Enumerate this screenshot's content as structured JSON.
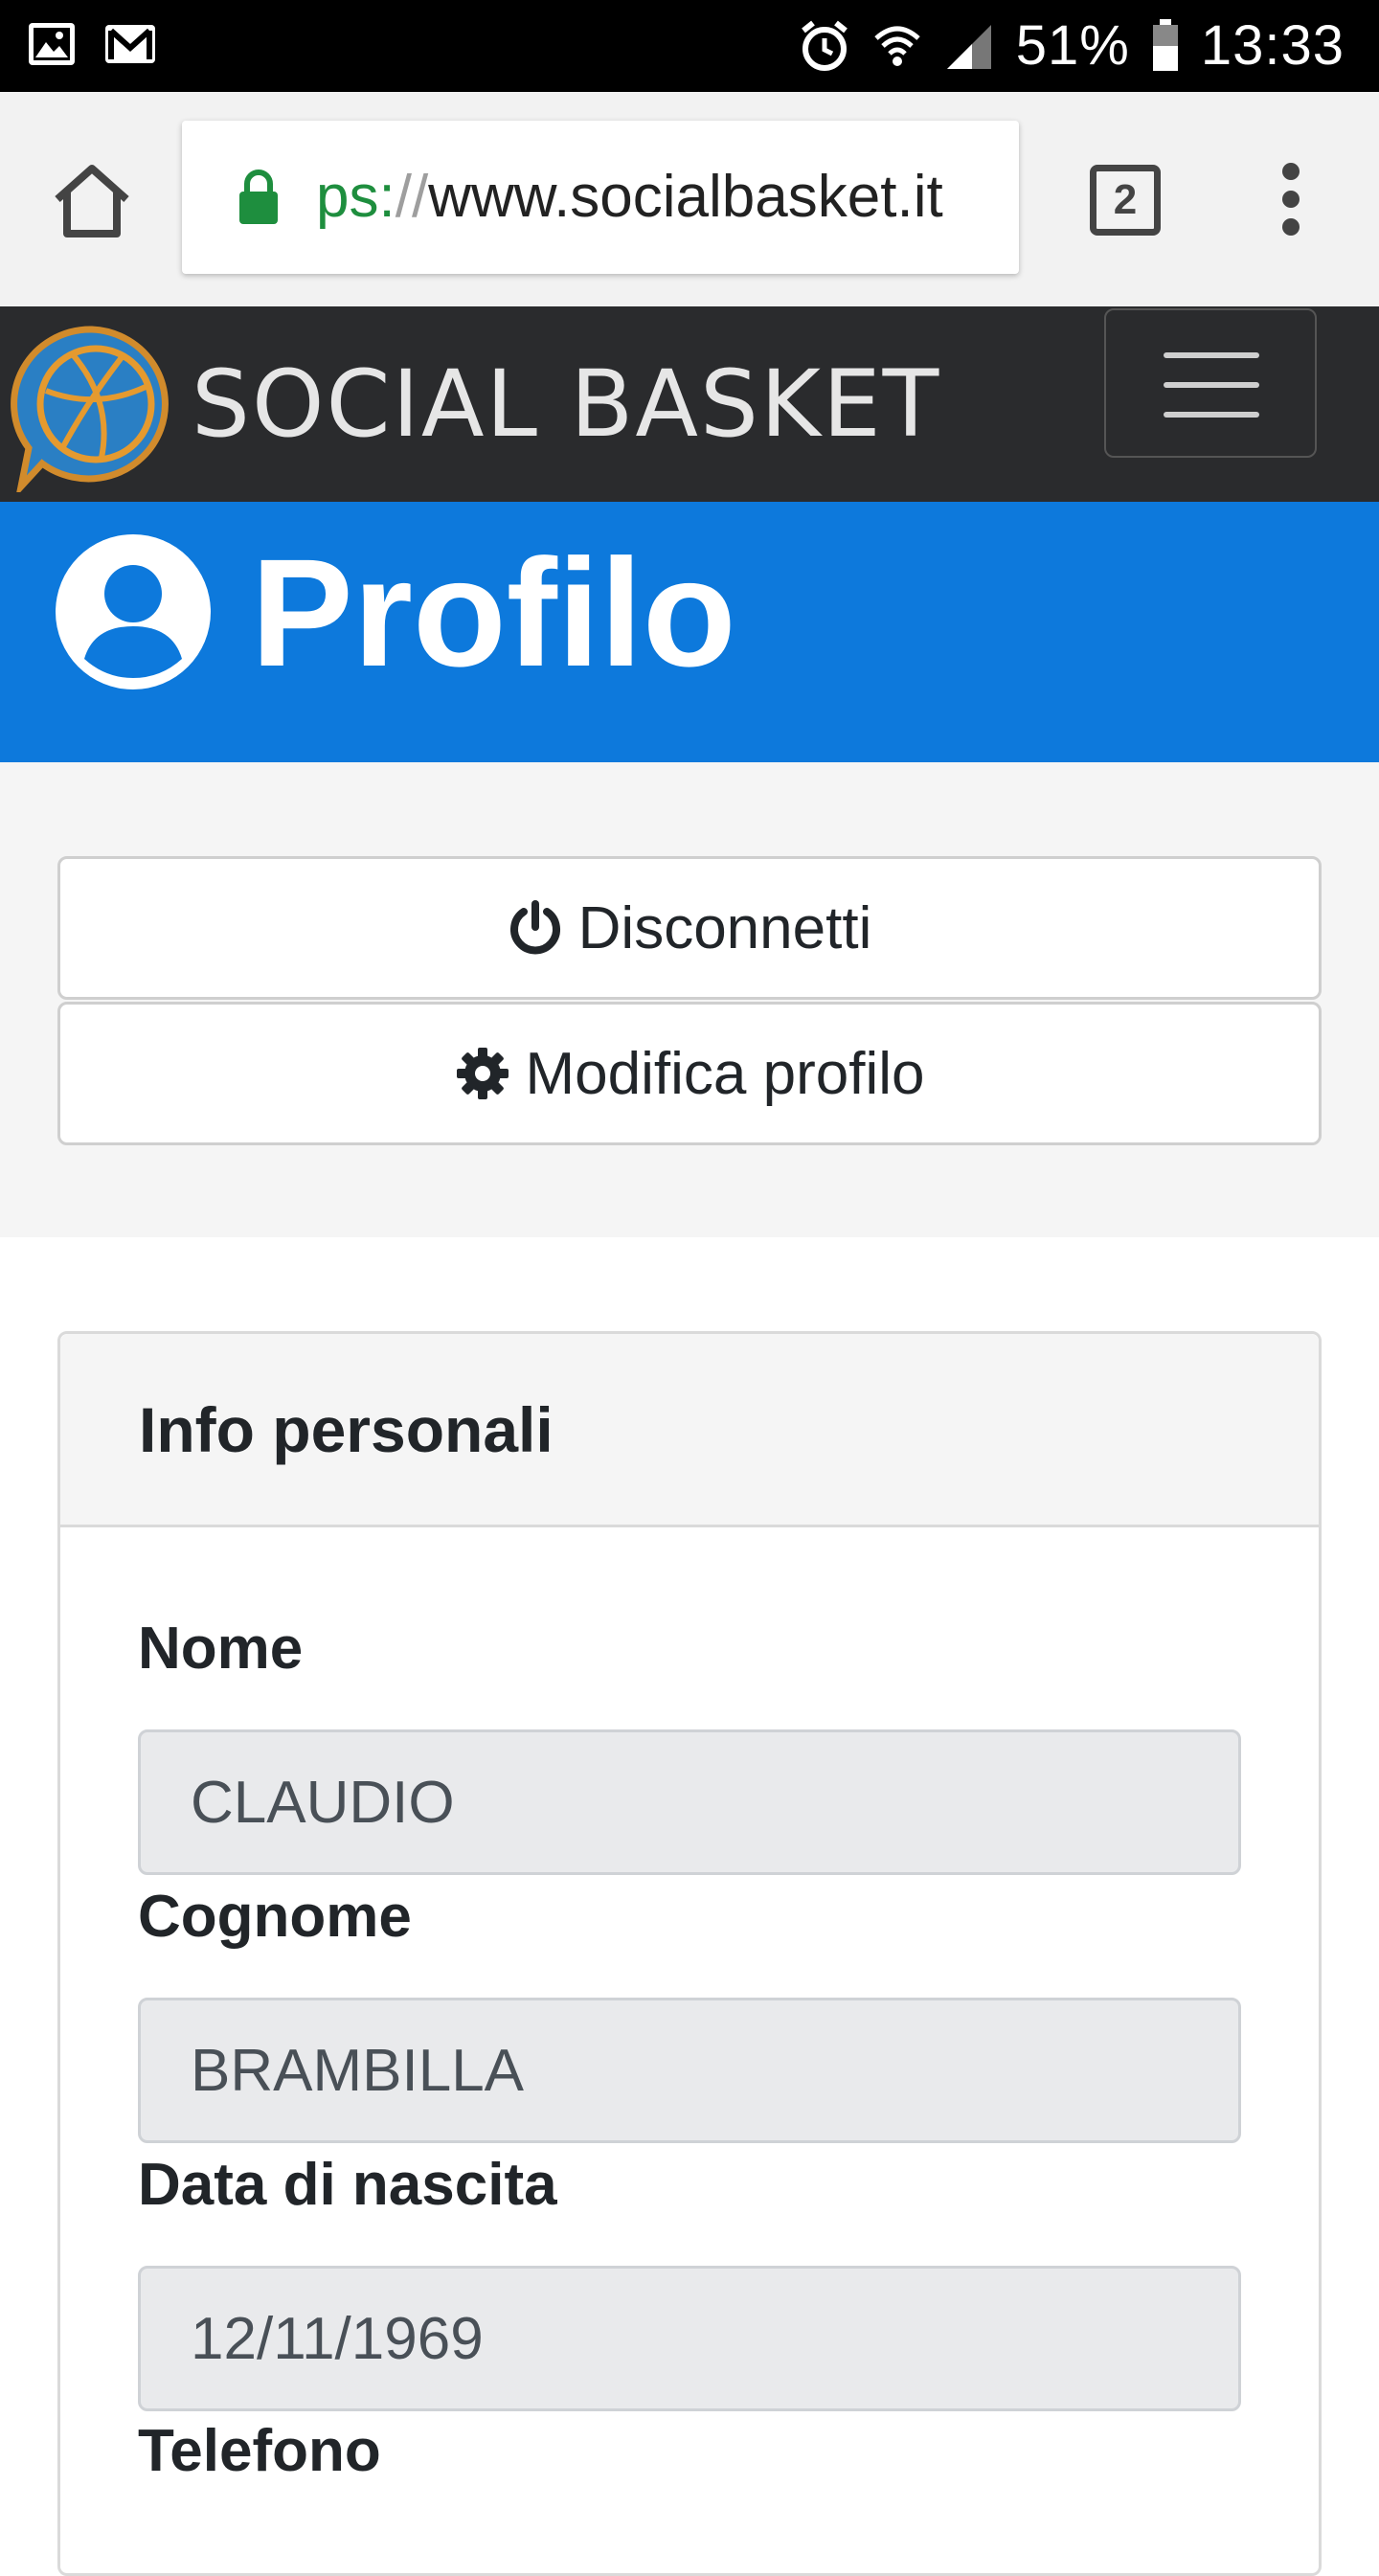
{
  "status_bar": {
    "battery": "51%",
    "time": "13:33",
    "icons": [
      "image-icon",
      "gmail-icon",
      "alarm-icon",
      "wifi-icon",
      "signal-icon",
      "battery-icon"
    ]
  },
  "browser": {
    "url_scheme": "ps:",
    "url_sep": "//",
    "url_host": "www.socialbasket.it",
    "tab_count": "2"
  },
  "site": {
    "brand": "SOCIAL BASKET",
    "accent_color": "#0d79dc",
    "navbar_color": "#2a2b2d"
  },
  "page": {
    "title": "Profilo"
  },
  "actions": {
    "logout_label": "Disconnetti",
    "edit_label": "Modifica profilo"
  },
  "card": {
    "title": "Info personali",
    "fields": [
      {
        "label": "Nome",
        "value": "CLAUDIO"
      },
      {
        "label": "Cognome",
        "value": "BRAMBILLA"
      },
      {
        "label": "Data di nascita",
        "value": "12/11/1969"
      },
      {
        "label": "Telefono",
        "value": ""
      }
    ]
  }
}
